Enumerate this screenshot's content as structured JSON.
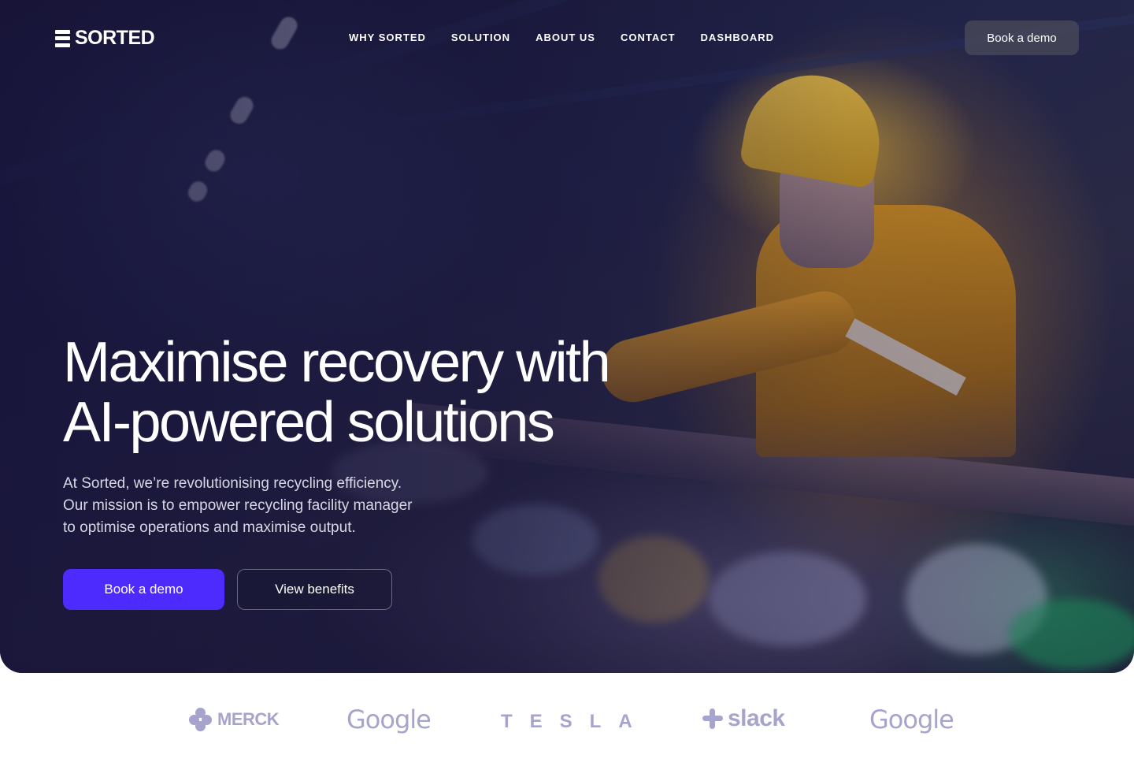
{
  "brand": {
    "name": "SORTED"
  },
  "nav": {
    "items": [
      {
        "label": "WHY SORTED"
      },
      {
        "label": "SOLUTION"
      },
      {
        "label": "ABOUT US"
      },
      {
        "label": "CONTACT"
      },
      {
        "label": "DASHBOARD"
      }
    ],
    "cta_label": "Book a demo"
  },
  "hero": {
    "headline_line1": "Maximise recovery with",
    "headline_line2": "AI-powered solutions",
    "subtext_line1": "At Sorted, we’re revolutionising recycling efficiency.",
    "subtext_line2": "Our mission is to empower recycling facility manager",
    "subtext_line3": "to optimise operations and maximise output.",
    "primary_button": "Book a demo",
    "secondary_button": "View benefits"
  },
  "partners": {
    "logos": [
      {
        "text": "MERCK",
        "icon": "merck-logo"
      },
      {
        "text": "Google",
        "icon": "google-logo"
      },
      {
        "text": "TESLA",
        "icon": "tesla-logo"
      },
      {
        "text": "slack",
        "icon": "slack-logo"
      },
      {
        "text": "Google",
        "icon": "google-logo"
      }
    ]
  },
  "colors": {
    "accent": "#4d2bff",
    "hero_overlay": "#161238",
    "logo_gray": "#a6a3cc"
  }
}
